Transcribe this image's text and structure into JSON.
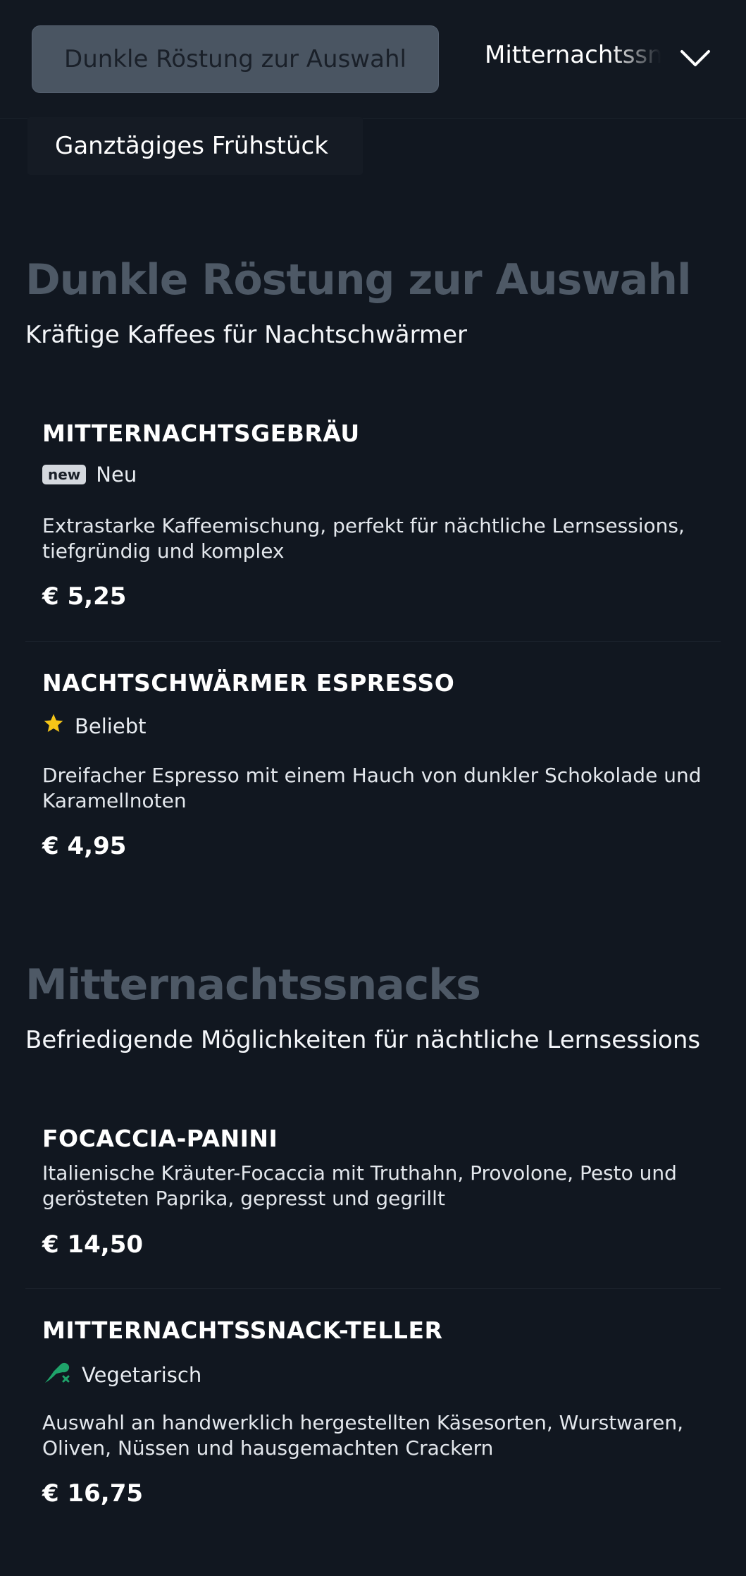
{
  "nav": {
    "active_tab": "Dunkle Röstung zur Auswahl",
    "next_tab": "Mitternachtssnacks",
    "dropdown_icon": "chevron-down-icon",
    "chip": "Ganztägiges Frühstück"
  },
  "sections": [
    {
      "title": "Dunkle Röstung zur Auswahl",
      "subtitle": "Kräftige Kaffees für Nachtschwärmer",
      "items": [
        {
          "name": "MITTERNACHTSGEBRÄU",
          "tag": "new",
          "badge": "Neu",
          "description": "Extrastarke Kaffeemischung, perfekt für nächtliche Lernsessions, tiefgründig und komplex",
          "price": "€ 5,25"
        },
        {
          "name": "NACHTSCHWÄRMER ESPRESSO",
          "badge_icon": "star-icon",
          "badge": "Beliebt",
          "description": "Dreifacher Espresso mit einem Hauch von dunkler Schokolade und Karamellnoten",
          "price": "€ 4,95"
        }
      ]
    },
    {
      "title": "Mitternachtssnacks",
      "subtitle": "Befriedigende Möglichkeiten für nächtliche Lernsessions",
      "items": [
        {
          "name": "FOCACCIA-PANINI",
          "description": "Italienische Kräuter-Focaccia mit Truthahn, Provolone, Pesto und gerösteten Paprika, gepresst und gegrillt",
          "price": "€ 14,50"
        },
        {
          "name": "MITTERNACHTSSNACK-TELLER",
          "badge_icon": "vegetarian-icon",
          "badge": "Vegetarisch",
          "description": "Auswahl an handwerklich hergestellten Käsesorten, Wurstwaren, Oliven, Nüssen und hausgemachten Crackern",
          "price": "€ 16,75"
        }
      ]
    }
  ],
  "colors": {
    "background": "#111720",
    "active_tab": "#4a5562",
    "section_title": "#4e5966",
    "star": "#f5c518",
    "vegetarian": "#1fa36a"
  }
}
